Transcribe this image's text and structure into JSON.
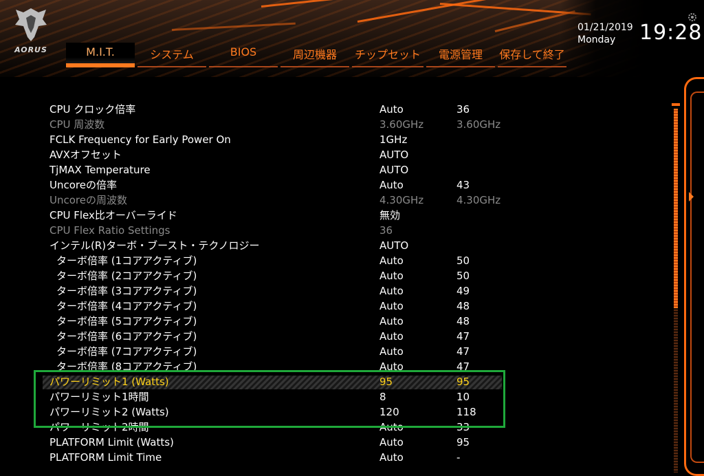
{
  "header": {
    "logo_text": "AORUS",
    "date": "01/21/2019",
    "weekday": "Monday",
    "time": "19:28"
  },
  "tabs": [
    {
      "label": "M.I.T.",
      "active": true
    },
    {
      "label": "システム",
      "active": false
    },
    {
      "label": "BIOS",
      "active": false
    },
    {
      "label": "周辺機器",
      "active": false
    },
    {
      "label": "チップセット",
      "active": false
    },
    {
      "label": "電源管理",
      "active": false
    },
    {
      "label": "保存して終了",
      "active": false
    }
  ],
  "settings": [
    {
      "label": "CPU クロック倍率",
      "value": "Auto",
      "current": "36",
      "state": "normal"
    },
    {
      "label": "CPU 周波数",
      "value": "3.60GHz",
      "current": "3.60GHz",
      "state": "disabled"
    },
    {
      "label": "FCLK Frequency for Early Power On",
      "value": "1GHz",
      "current": "",
      "state": "normal"
    },
    {
      "label": "AVXオフセット",
      "value": "AUTO",
      "current": "",
      "state": "normal"
    },
    {
      "label": "TjMAX Temperature",
      "value": "AUTO",
      "current": "",
      "state": "normal"
    },
    {
      "label": "Uncoreの倍率",
      "value": "Auto",
      "current": "43",
      "state": "normal"
    },
    {
      "label": "Uncoreの周波数",
      "value": "4.30GHz",
      "current": "4.30GHz",
      "state": "disabled"
    },
    {
      "label": "CPU Flex比オーバーライド",
      "value": "無効",
      "current": "",
      "state": "normal"
    },
    {
      "label": "CPU Flex Ratio Settings",
      "value": "36",
      "current": "",
      "state": "disabled"
    },
    {
      "label": "インテル(R)ターボ・ブースト・テクノロジー",
      "value": "AUTO",
      "current": "",
      "state": "normal"
    },
    {
      "label": "ターボ倍率 (1コアアクティブ)",
      "value": "Auto",
      "current": "50",
      "state": "indent"
    },
    {
      "label": "ターボ倍率 (2コアアクティブ)",
      "value": "Auto",
      "current": "50",
      "state": "indent"
    },
    {
      "label": "ターボ倍率 (3コアアクティブ)",
      "value": "Auto",
      "current": "49",
      "state": "indent"
    },
    {
      "label": "ターボ倍率 (4コアアクティブ)",
      "value": "Auto",
      "current": "48",
      "state": "indent"
    },
    {
      "label": "ターボ倍率 (5コアアクティブ)",
      "value": "Auto",
      "current": "48",
      "state": "indent"
    },
    {
      "label": "ターボ倍率 (6コアアクティブ)",
      "value": "Auto",
      "current": "47",
      "state": "indent"
    },
    {
      "label": "ターボ倍率 (7コアアクティブ)",
      "value": "Auto",
      "current": "47",
      "state": "indent"
    },
    {
      "label": "ターボ倍率 (8コアアクティブ)",
      "value": "Auto",
      "current": "47",
      "state": "indent"
    },
    {
      "label": "パワーリミット1 (Watts)",
      "value": "95",
      "current": "95",
      "state": "selected"
    },
    {
      "label": "パワーリミット1時間",
      "value": "8",
      "current": "10",
      "state": "normal"
    },
    {
      "label": "パワーリミット2 (Watts)",
      "value": "120",
      "current": "118",
      "state": "normal"
    },
    {
      "label": "パワーリミット2時間",
      "value": "Auto",
      "current": "33",
      "state": "normal"
    },
    {
      "label": "PLATFORM Limit (Watts)",
      "value": "Auto",
      "current": "95",
      "state": "normal"
    },
    {
      "label": "PLATFORM Limit Time",
      "value": "Auto",
      "current": "-",
      "state": "normal"
    }
  ],
  "scrollbar": {
    "position_fraction": 0.0,
    "visible_fraction": 0.55
  },
  "colors": {
    "accent": "#ff7a1f",
    "selected_text": "#ffd21a",
    "highlight_box": "#1fa83a",
    "disabled_text": "#8a8a8a"
  }
}
